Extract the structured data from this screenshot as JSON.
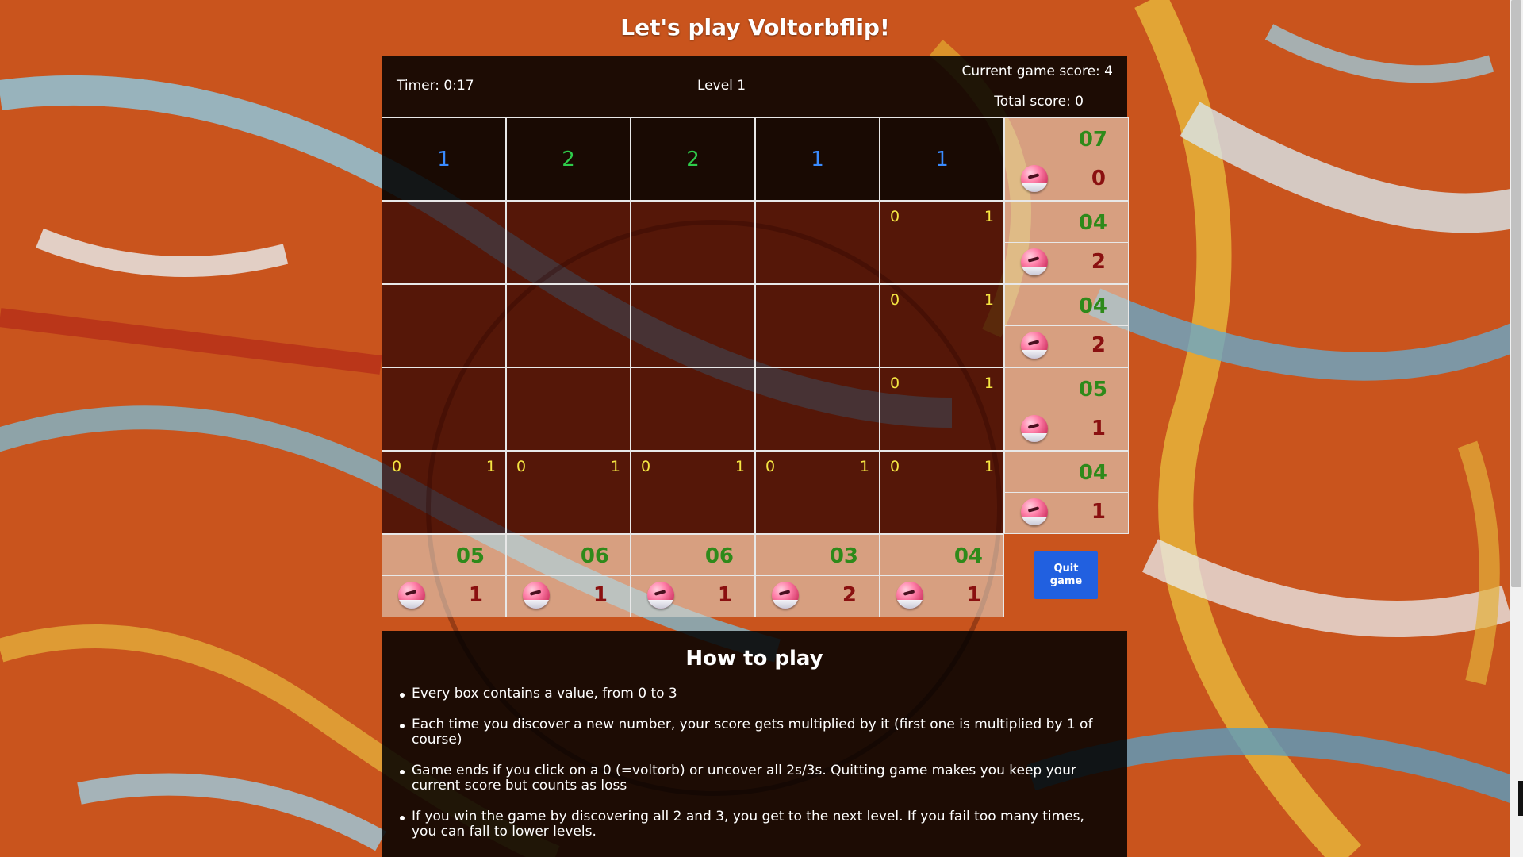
{
  "title": "Let's play Voltorbflip!",
  "header": {
    "timer": "Timer: 0:17",
    "level": "Level 1",
    "current_score": "Current game score: 4",
    "total_score": "Total score: 0"
  },
  "grid": {
    "rows": [
      [
        {
          "state": "revealed",
          "value": "1",
          "color": "#3a8bff"
        },
        {
          "state": "revealed",
          "value": "2",
          "color": "#2ecb4a"
        },
        {
          "state": "revealed",
          "value": "2",
          "color": "#2ecb4a"
        },
        {
          "state": "revealed",
          "value": "1",
          "color": "#3a8bff"
        },
        {
          "state": "revealed",
          "value": "1",
          "color": "#3a8bff"
        }
      ],
      [
        {
          "state": "hidden"
        },
        {
          "state": "hidden"
        },
        {
          "state": "hidden"
        },
        {
          "state": "hidden"
        },
        {
          "state": "hidden",
          "memo_left": "0",
          "memo_right": "1"
        }
      ],
      [
        {
          "state": "hidden"
        },
        {
          "state": "hidden"
        },
        {
          "state": "hidden"
        },
        {
          "state": "hidden"
        },
        {
          "state": "hidden",
          "memo_left": "0",
          "memo_right": "1"
        }
      ],
      [
        {
          "state": "hidden"
        },
        {
          "state": "hidden"
        },
        {
          "state": "hidden"
        },
        {
          "state": "hidden"
        },
        {
          "state": "hidden",
          "memo_left": "0",
          "memo_right": "1"
        }
      ],
      [
        {
          "state": "hidden",
          "memo_left": "0",
          "memo_right": "1"
        },
        {
          "state": "hidden",
          "memo_left": "0",
          "memo_right": "1"
        },
        {
          "state": "hidden",
          "memo_left": "0",
          "memo_right": "1"
        },
        {
          "state": "hidden",
          "memo_left": "0",
          "memo_right": "1"
        },
        {
          "state": "hidden",
          "memo_left": "0",
          "memo_right": "1"
        }
      ]
    ],
    "row_hints": [
      {
        "sum": "07",
        "voltorbs": "0"
      },
      {
        "sum": "04",
        "voltorbs": "2"
      },
      {
        "sum": "04",
        "voltorbs": "2"
      },
      {
        "sum": "05",
        "voltorbs": "1"
      },
      {
        "sum": "04",
        "voltorbs": "1"
      }
    ],
    "col_hints": [
      {
        "sum": "05",
        "voltorbs": "1"
      },
      {
        "sum": "06",
        "voltorbs": "1"
      },
      {
        "sum": "06",
        "voltorbs": "1"
      },
      {
        "sum": "03",
        "voltorbs": "2"
      },
      {
        "sum": "04",
        "voltorbs": "1"
      }
    ]
  },
  "quit_button": {
    "line1": "Quit",
    "line2": "game"
  },
  "colors": {
    "hint_sum": "#2e8a1a",
    "hint_voltorbs": "#8a1010",
    "memo": "#f5e642",
    "quit_button": "#2160e0"
  },
  "icons": {
    "voltorb": "voltorb-icon"
  },
  "how_to_play": {
    "title": "How to play",
    "rules": [
      "Every box contains a value, from 0 to 3",
      "Each time you discover a new number, your score gets multiplied by it (first one is multiplied by 1 of course)",
      "Game ends if you click on a 0 (=voltorb) or uncover all 2s/3s. Quitting game makes you keep your current score but counts as loss",
      "If you win the game by discovering all 2 and 3, you get to the next level. If you fail too many times, you can fall to lower levels."
    ]
  }
}
